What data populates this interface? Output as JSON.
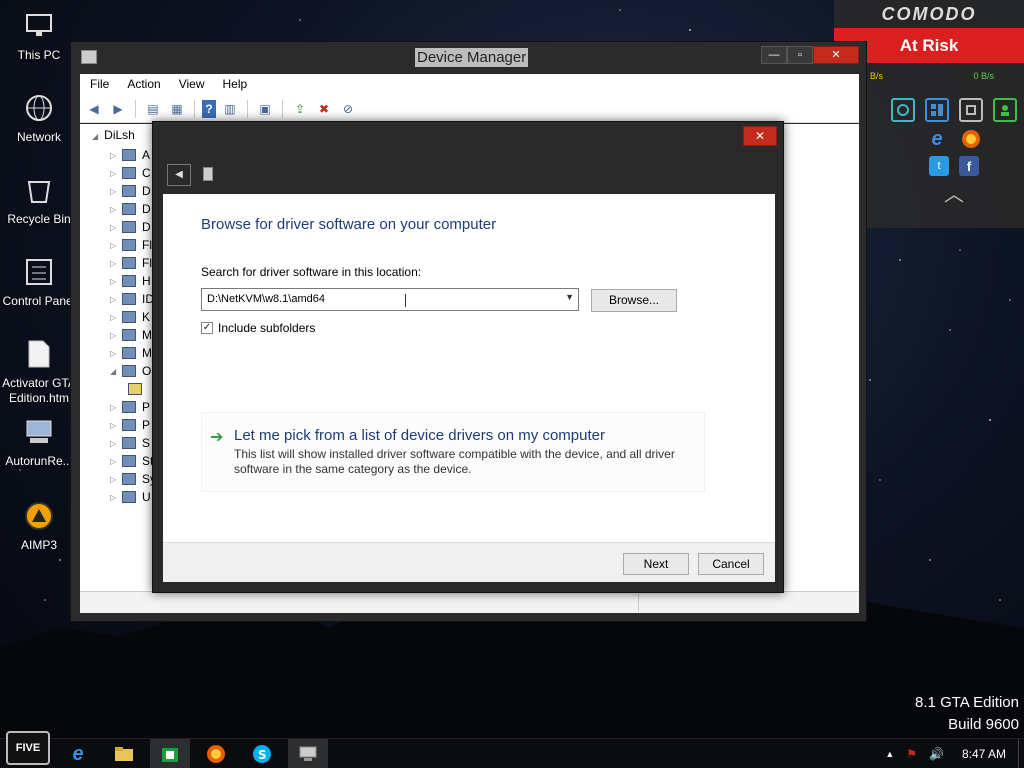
{
  "desktop": {
    "icons": [
      {
        "label": "This PC",
        "icon": "monitor-icon"
      },
      {
        "label": "Network",
        "icon": "globe-icon"
      },
      {
        "label": "Recycle Bin",
        "icon": "trash-icon"
      },
      {
        "label": "Control Panel",
        "icon": "sliders-icon"
      },
      {
        "label": "Activator GTA",
        "label2": "Edition.htm",
        "icon": "document-icon"
      },
      {
        "label": "AutorunRe...",
        "icon": "computer-icon"
      },
      {
        "label": "AIMP3",
        "icon": "aimp-icon"
      }
    ],
    "edition": {
      "line1": "8.1 GTA Edition",
      "line2": "Build 9600"
    }
  },
  "comodo": {
    "brand": "COMODO",
    "status": "At Risk",
    "upload": "B/s",
    "download": "0 B/s",
    "colors": {
      "status_bg": "#d91f1f",
      "upload": "#f5c400",
      "download": "#5bd24c"
    }
  },
  "device_manager": {
    "title": "Device Manager",
    "menu": [
      "File",
      "Action",
      "View",
      "Help"
    ],
    "tree": {
      "root": "DiLsh",
      "items": [
        "A",
        "C",
        "D",
        "D",
        "D",
        "Fl",
        "Fl",
        "H",
        "ID",
        "K",
        "M",
        "M",
        "O",
        "",
        "P",
        "P",
        "S",
        "St",
        "Sy",
        "U"
      ]
    }
  },
  "dialog": {
    "heading": "Browse for driver software on your computer",
    "path_label": "Search for driver software in this location:",
    "path_value": "D:\\NetKVM\\w8.1\\amd64",
    "browse_label": "Browse...",
    "include_subfolders": "Include subfolders",
    "include_checked": true,
    "pick_title": "Let me pick from a list of device drivers on my computer",
    "pick_desc": "This list will show installed driver software compatible with the device, and all driver software in the same category as the device.",
    "next_label": "Next",
    "cancel_label": "Cancel",
    "close_glyph": "✕"
  },
  "taskbar": {
    "start_label": "FIVE",
    "apps": [
      "internet-explorer-icon",
      "file-explorer-icon",
      "store-icon",
      "firefox-icon",
      "skype-icon",
      "device-manager-icon"
    ],
    "time": "8:47 AM"
  }
}
